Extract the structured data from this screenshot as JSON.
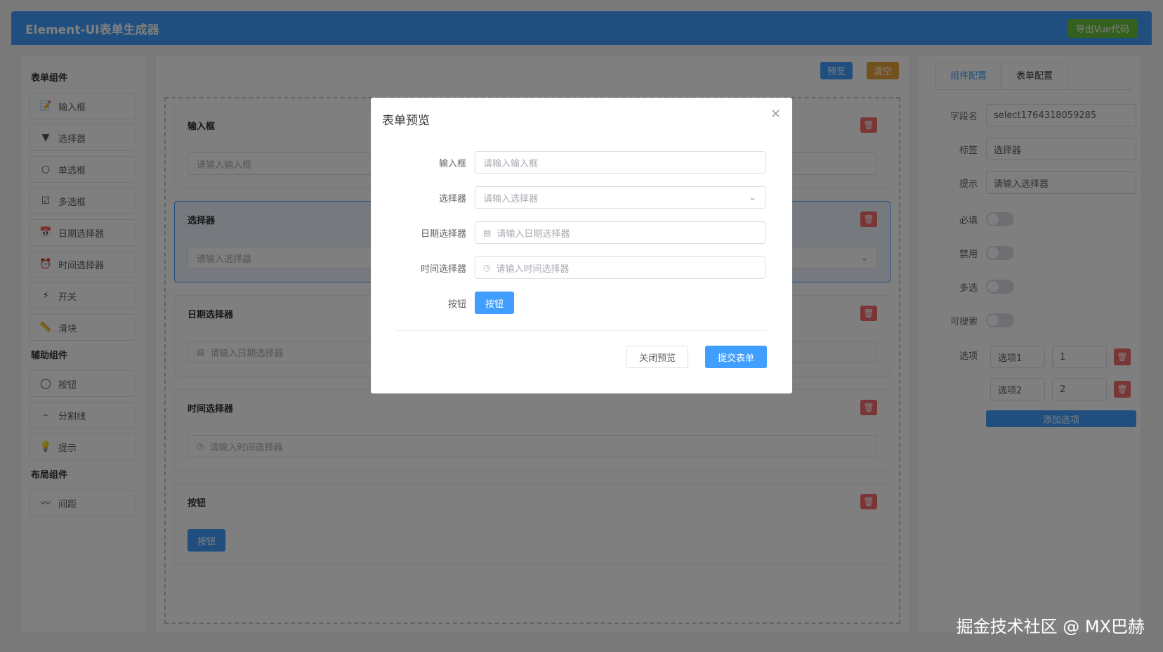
{
  "header": {
    "title": "Element-UI表单生成器",
    "export_label": "导出Vue代码"
  },
  "left": {
    "form_group_title": "表单组件",
    "form_items": [
      {
        "icon": "input-icon",
        "label": "输入框"
      },
      {
        "icon": "select-icon",
        "label": "选择器"
      },
      {
        "icon": "radio-icon",
        "label": "单选框"
      },
      {
        "icon": "checkbox-icon",
        "label": "多选框"
      },
      {
        "icon": "calendar-icon",
        "label": "日期选择器"
      },
      {
        "icon": "alarm-clock-icon",
        "label": "时间选择器"
      },
      {
        "icon": "lightning-icon",
        "label": "开关"
      },
      {
        "icon": "ruler-icon",
        "label": "滑块"
      }
    ],
    "aux_group_title": "辅助组件",
    "aux_items": [
      {
        "icon": "circle-icon",
        "label": "按钮"
      },
      {
        "icon": "dash-icon",
        "label": "分割线"
      },
      {
        "icon": "lightbulb-icon",
        "label": "提示"
      }
    ],
    "layout_group_title": "布局组件",
    "layout_items": [
      {
        "icon": "wave-icon",
        "label": "间距"
      }
    ]
  },
  "toolbar": {
    "preview_label": "预览",
    "clear_label": "清空"
  },
  "canvas": {
    "fields": [
      {
        "label": "输入框",
        "placeholder": "请输入输入框",
        "type": "input"
      },
      {
        "label": "选择器",
        "placeholder": "请输入选择器",
        "type": "select"
      },
      {
        "label": "日期选择器",
        "placeholder": "请输入日期选择器",
        "type": "date"
      },
      {
        "label": "时间选择器",
        "placeholder": "请输入时间选择器",
        "type": "time"
      },
      {
        "label": "按钮",
        "button_label": "按钮",
        "type": "button"
      }
    ]
  },
  "right": {
    "tabs": [
      "组件配置",
      "表单配置"
    ],
    "field_name_label": "字段名",
    "field_name_value": "select1764318059285",
    "tag_label": "标签",
    "tag_value": "选择器",
    "hint_label": "提示",
    "hint_value": "请输入选择器",
    "required_label": "必填",
    "disabled_label": "禁用",
    "multiple_label": "多选",
    "searchable_label": "可搜索",
    "options_label": "选项",
    "options": [
      {
        "label": "选项1",
        "value": "1"
      },
      {
        "label": "选项2",
        "value": "2"
      }
    ],
    "add_option_label": "添加选项"
  },
  "modal": {
    "title": "表单预览",
    "close_icon": "×",
    "rows": [
      {
        "label": "输入框",
        "placeholder": "请输入输入框"
      },
      {
        "label": "选择器",
        "placeholder": "请输入选择器"
      },
      {
        "label": "日期选择器",
        "placeholder": "请输入日期选择器"
      },
      {
        "label": "时间选择器",
        "placeholder": "请输入时间选择器"
      },
      {
        "label": "按钮",
        "button_label": "按钮"
      }
    ],
    "close_preview_label": "关闭预览",
    "submit_label": "提交表单"
  },
  "watermark": "掘金技术社区 @ MX巴赫"
}
